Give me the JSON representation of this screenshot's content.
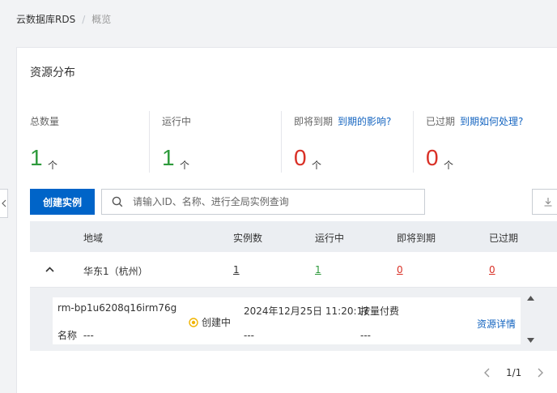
{
  "breadcrumb": {
    "root": "云数据库RDS",
    "separator": "/",
    "current": "概览"
  },
  "section_title": "资源分布",
  "stats": [
    {
      "label": "总数量",
      "link": "",
      "value": "1",
      "unit": "个",
      "color": "#2e9a3c"
    },
    {
      "label": "运行中",
      "link": "",
      "value": "1",
      "unit": "个",
      "color": "#2e9a3c"
    },
    {
      "label": "即将到期",
      "link": "到期的影响?",
      "value": "0",
      "unit": "个",
      "color": "#d93026"
    },
    {
      "label": "已过期",
      "link": "到期如何处理?",
      "value": "0",
      "unit": "个",
      "color": "#d93026"
    }
  ],
  "toolbar": {
    "create_label": "创建实例",
    "search_placeholder": "请输入ID、名称、进行全局实例查询"
  },
  "table": {
    "headers": [
      "地域",
      "实例数",
      "运行中",
      "即将到期",
      "已过期"
    ],
    "region_row": {
      "region": "华东1（杭州）",
      "instances": "1",
      "running": "1",
      "expiring": "0",
      "expired": "0"
    }
  },
  "instance": {
    "id": "rm-bp1u6208q16irm76g",
    "name_label": "名称",
    "name_value": "---",
    "status": "创建中",
    "time": "2024年12月25日 11:20:17",
    "time_sub": "---",
    "pay_type": "按量付费",
    "pay_sub": "---",
    "detail_link": "资源详情"
  },
  "pager": {
    "text": "1/1"
  },
  "colors": {
    "primary": "#0064c8",
    "link": "#1565c0",
    "green": "#2e9a3c",
    "red": "#d93026",
    "status_yellow": "#f0b400"
  }
}
